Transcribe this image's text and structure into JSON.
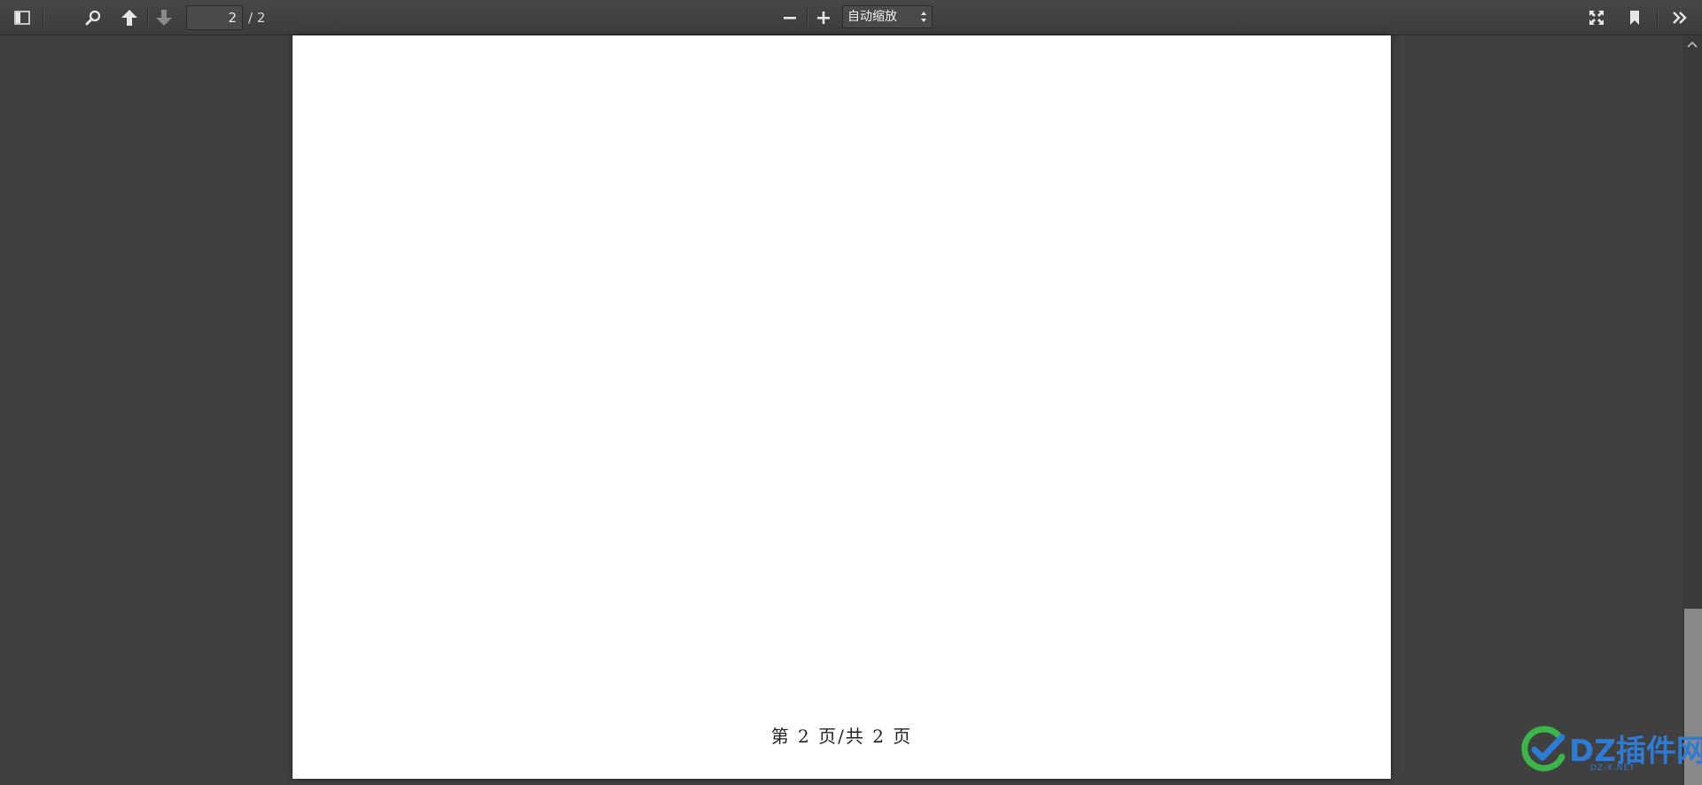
{
  "toolbar": {
    "page_number": "2",
    "page_count": "/ 2",
    "zoom_value": "自动缩放",
    "icons": {
      "sidebar_toggle": "sidebar-toggle-icon",
      "search": "search-icon",
      "previous": "arrow-up-icon",
      "next": "arrow-down-icon",
      "zoom_out": "minus-icon",
      "zoom_in": "plus-icon",
      "presentation": "fullscreen-icon",
      "bookmark": "bookmark-icon",
      "tools": "double-chevron-right-icon"
    }
  },
  "document": {
    "footer_text": "第 2 页/共 2 页"
  },
  "watermark": {
    "brand": "DZ插件网",
    "sub": "DZ-X.NET"
  },
  "colors": {
    "toolbar_bg": "#404040",
    "viewer_bg": "#404040",
    "page_bg": "#ffffff",
    "watermark_blue": "#2e7bd6",
    "watermark_green": "#3cb54a"
  }
}
